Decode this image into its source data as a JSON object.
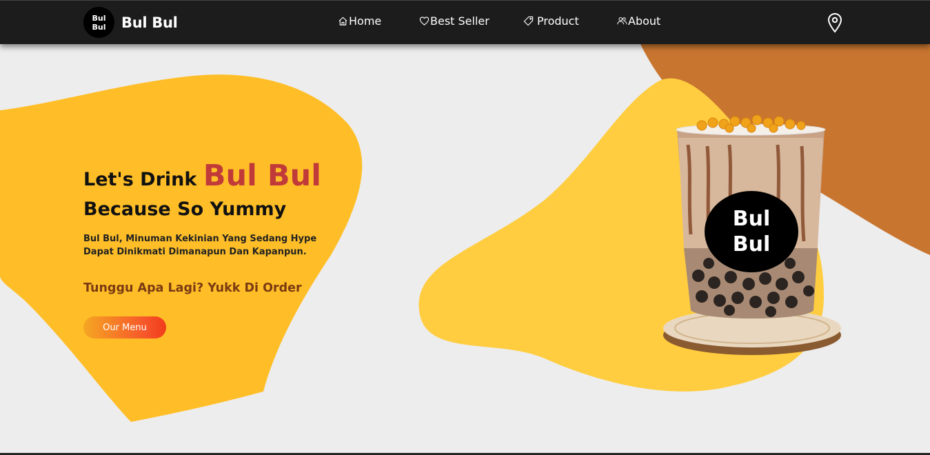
{
  "brand": {
    "logo_text": "Bul Bul",
    "name": "Bul Bul"
  },
  "nav": {
    "items": [
      {
        "label": "Home",
        "icon": "home-icon"
      },
      {
        "label": "Best Seller",
        "icon": "heart-icon"
      },
      {
        "label": "Product",
        "icon": "tag-icon"
      },
      {
        "label": "About",
        "icon": "users-icon"
      }
    ],
    "location_icon": "map-pin-icon"
  },
  "hero": {
    "headline_prefix": "Let's Drink ",
    "headline_brand": "Bul Bul",
    "headline_line2": "Because So Yummy",
    "description_line1": "Bul Bul, Minuman Kekinian Yang Sedang Hype",
    "description_line2": "Dapat Dinikmati Dimanapun Dan Kapanpun.",
    "cta": "Tunggu Apa Lagi? Yukk Di Order",
    "button_label": "Our Menu"
  },
  "product": {
    "badge_text": "Bul Bul"
  },
  "colors": {
    "navbar": "#1c1c1c",
    "background": "#ededed",
    "yellow_blob": "#ffbe27",
    "yellow_blob_right": "#ffcd3f",
    "brown_blob": "#c87530",
    "accent_red": "#c13a3a",
    "cta_brown": "#7a3a12"
  }
}
